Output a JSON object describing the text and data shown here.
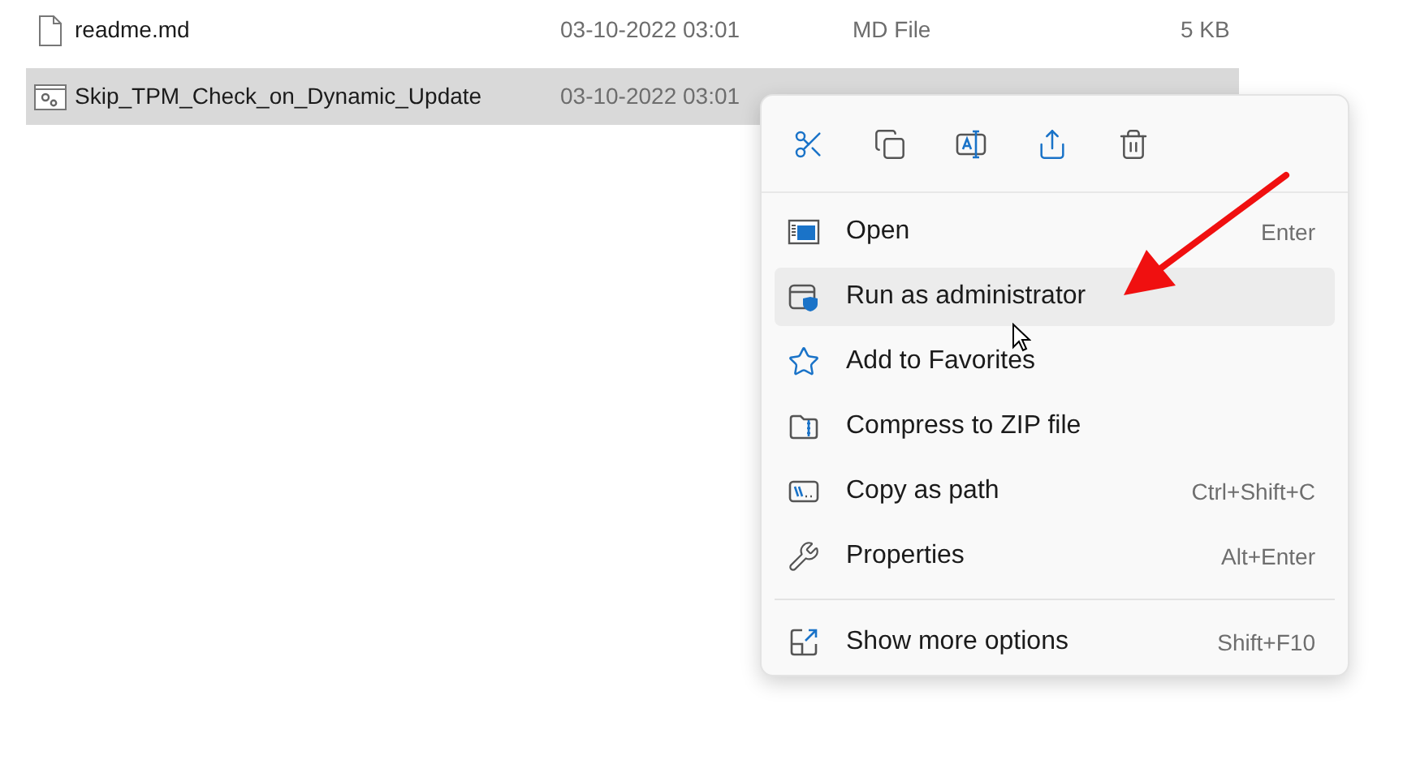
{
  "files": [
    {
      "name": "readme.md",
      "kind": "document",
      "date": "03-10-2022 03:01",
      "type": "MD File",
      "size": "5 KB",
      "selected": false
    },
    {
      "name": "Skip_TPM_Check_on_Dynamic_Update",
      "kind": "script",
      "date": "03-10-2022 03:01",
      "selected": true
    }
  ],
  "context_menu": {
    "items": [
      {
        "label": "Open",
        "shortcut": "Enter",
        "selected": false
      },
      {
        "label": "Run as administrator",
        "selected": true
      },
      {
        "label": "Add to Favorites",
        "selected": false
      },
      {
        "label": "Compress to ZIP file",
        "selected": false
      },
      {
        "label": "Copy as path",
        "shortcut": "Ctrl+Shift+C",
        "selected": false
      },
      {
        "label": "Properties",
        "shortcut": "Alt+Enter",
        "selected": false
      }
    ],
    "more_item": {
      "label": "Show more options",
      "shortcut": "Shift+F10",
      "selected": false
    }
  }
}
